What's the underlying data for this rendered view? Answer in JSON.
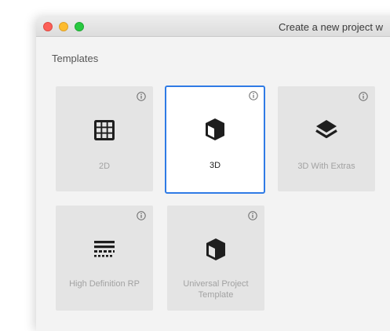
{
  "window": {
    "title": "Create a new project w"
  },
  "templates": {
    "section_label": "Templates",
    "items": [
      {
        "label": "2D",
        "icon": "grid-icon",
        "selected": false
      },
      {
        "label": "3D",
        "icon": "cube-icon",
        "selected": true
      },
      {
        "label": "3D With Extras",
        "icon": "layers-icon",
        "selected": false
      },
      {
        "label": "High Definition RP",
        "icon": "hdrp-icon",
        "selected": false
      },
      {
        "label": "Universal Project Template",
        "icon": "cube-icon",
        "selected": false
      }
    ]
  },
  "colors": {
    "selection_border": "#2f7be5",
    "card_background": "#e4e4e4",
    "window_background": "#f3f3f3"
  }
}
